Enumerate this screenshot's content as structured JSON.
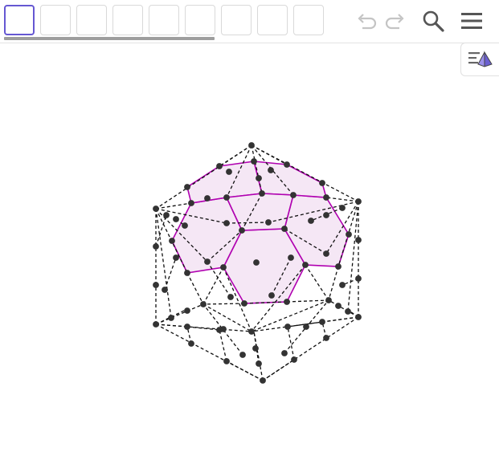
{
  "toolbar": {
    "tools": [
      {
        "name": "tool-move",
        "active": true
      },
      {
        "name": "tool-2",
        "active": false
      },
      {
        "name": "tool-3",
        "active": false
      },
      {
        "name": "tool-4",
        "active": false
      },
      {
        "name": "tool-5",
        "active": false
      },
      {
        "name": "tool-6",
        "active": false
      },
      {
        "name": "tool-7",
        "active": false
      },
      {
        "name": "tool-8",
        "active": false
      },
      {
        "name": "tool-9",
        "active": false
      }
    ],
    "icons": {
      "undo": "undo-icon",
      "redo": "redo-icon",
      "search": "search-icon",
      "menu": "menu-icon"
    }
  },
  "side_panel_toggle": {
    "icon": "graphics-view-icon"
  },
  "colors": {
    "accent": "#6557d2",
    "face_stroke": "#b000b0",
    "face_fill": "#f3e3f3",
    "point": "#333333",
    "edge": "#111111"
  }
}
